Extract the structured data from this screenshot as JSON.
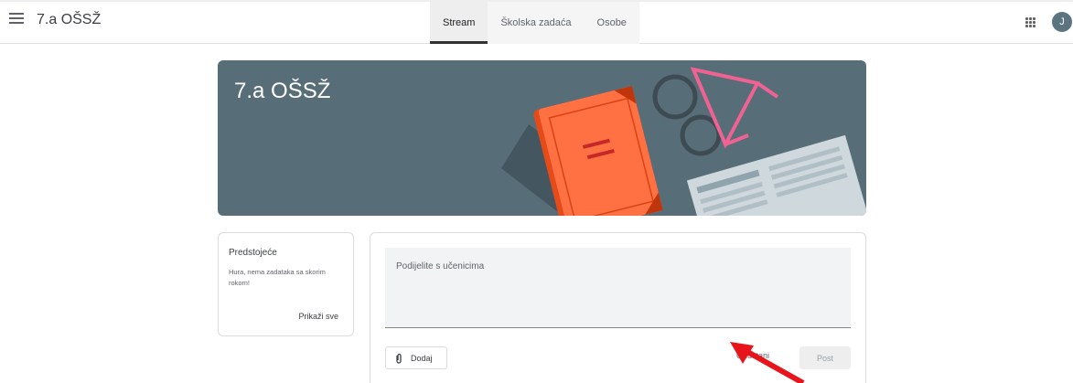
{
  "header": {
    "class_title": "7.a OŠSŽ",
    "menu_icon": "hamburger-menu-icon",
    "apps_icon": "google-apps-grid-icon",
    "avatar_letter": "J",
    "avatar_color": "#5c7480",
    "tabs": [
      {
        "label": "Stream",
        "active": true
      },
      {
        "label": "Školska zadaća",
        "active": false
      },
      {
        "label": "Osobe",
        "active": false
      }
    ]
  },
  "banner": {
    "title": "7.a OŠSŽ",
    "background_color": "#576d78",
    "illustration": "book-glasses-newspaper-illustration"
  },
  "upcoming": {
    "title": "Predstojeće",
    "message": "Hura, nema zadataka sa skorim rokom!",
    "view_all_label": "Prikaži sve"
  },
  "composer": {
    "placeholder": "Podijelite s učenicima",
    "add_label": "Dodaj",
    "attach_icon": "paperclip-icon",
    "cancel_label": "Odustani",
    "post_label": "Post"
  },
  "annotation": {
    "type": "red-arrow",
    "color": "#e8141c"
  }
}
